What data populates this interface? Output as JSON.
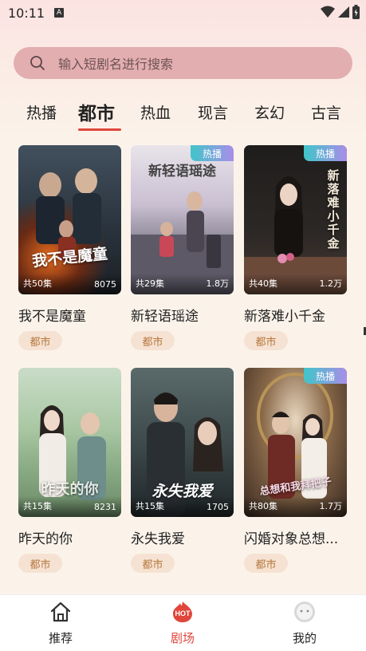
{
  "status": {
    "time": "10:11",
    "badge": "A"
  },
  "search": {
    "placeholder": "输入短剧名进行搜索"
  },
  "tabs": [
    {
      "label": "热播"
    },
    {
      "label": "都市"
    },
    {
      "label": "热血"
    },
    {
      "label": "现言"
    },
    {
      "label": "玄幻"
    },
    {
      "label": "古言"
    }
  ],
  "active_tab": "都市",
  "dramas": [
    {
      "name": "我不是魔童",
      "poster_title": "我不是魔童",
      "episodes": "共50集",
      "views": "8075",
      "tag": "都市",
      "hot": false,
      "hot_label": ""
    },
    {
      "name": "新轻语瑶途",
      "poster_title": "新轻语瑶途",
      "episodes": "共29集",
      "views": "1.8万",
      "tag": "都市",
      "hot": true,
      "hot_label": "热播"
    },
    {
      "name": "新落难小千金",
      "poster_title": "新落难小千金",
      "episodes": "共40集",
      "views": "1.2万",
      "tag": "都市",
      "hot": true,
      "hot_label": "热播"
    },
    {
      "name": "昨天的你",
      "poster_title": "昨天的你",
      "episodes": "共15集",
      "views": "8231",
      "tag": "都市",
      "hot": false,
      "hot_label": ""
    },
    {
      "name": "永失我爱",
      "poster_title": "永失我爱",
      "episodes": "共15集",
      "views": "1705",
      "tag": "都市",
      "hot": false,
      "hot_label": ""
    },
    {
      "name": "闪婚对象总想...",
      "poster_title": "总想和我拜把子",
      "episodes": "共80集",
      "views": "1.7万",
      "tag": "都市",
      "hot": true,
      "hot_label": "热播"
    }
  ],
  "nav": [
    {
      "label": "推荐",
      "icon": "home-icon"
    },
    {
      "label": "剧场",
      "icon": "hot-icon",
      "icon_text": "HOT"
    },
    {
      "label": "我的",
      "icon": "profile-icon"
    }
  ],
  "colors": {
    "accent": "#e0463b",
    "search_bg": "#e3aeb0",
    "tag_bg": "#f6e2d2",
    "tag_text": "#b5783f"
  }
}
